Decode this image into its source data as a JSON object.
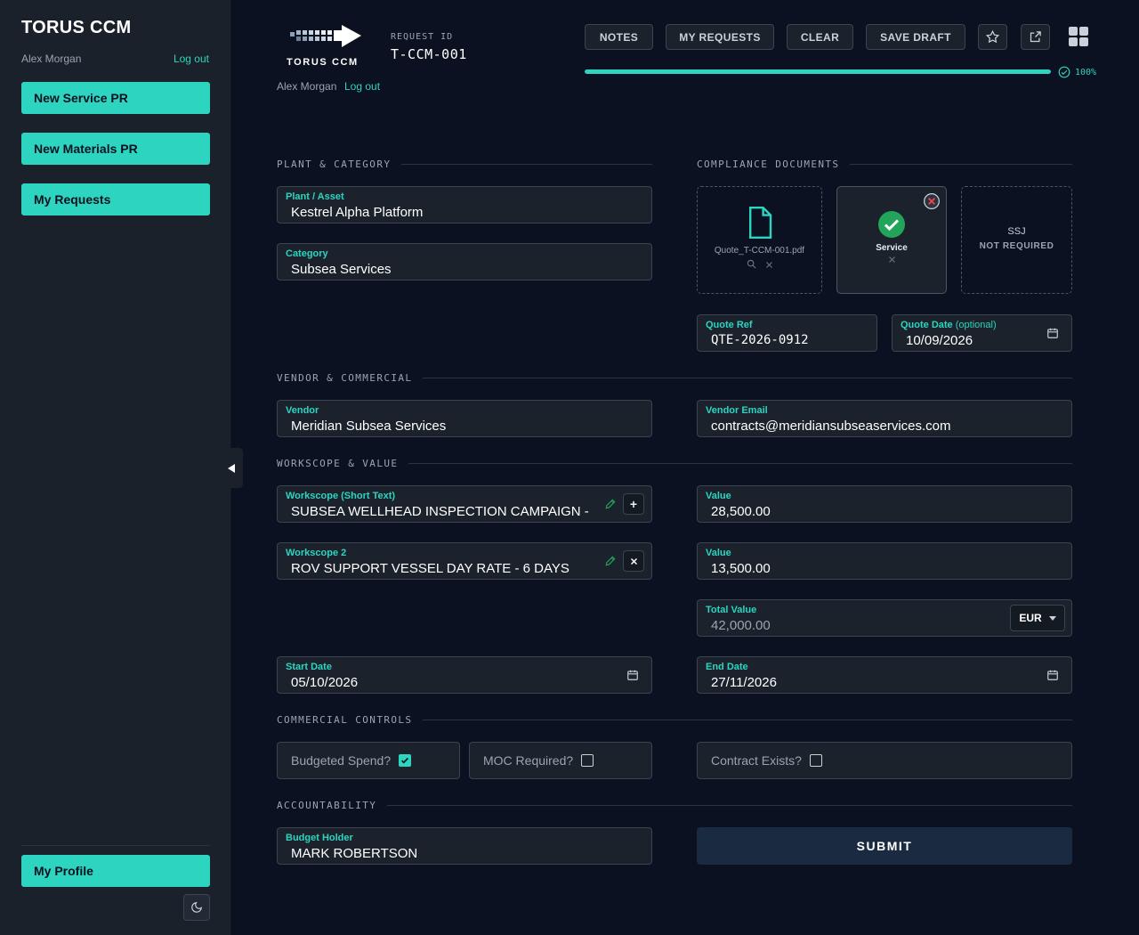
{
  "app": {
    "title": "TORUS CCM",
    "user": "Alex Morgan",
    "logout_label": "Log out"
  },
  "sidebar": {
    "items": [
      {
        "label": "New Service PR"
      },
      {
        "label": "New Materials PR"
      },
      {
        "label": "My Requests"
      }
    ],
    "profile_label": "My Profile"
  },
  "header": {
    "logo_text": "TORUS CCM",
    "request_id_label": "REQUEST ID",
    "request_id": "T-CCM-001",
    "buttons": {
      "notes": "NOTES",
      "my_requests": "MY REQUESTS",
      "clear": "CLEAR",
      "save_draft": "SAVE DRAFT"
    },
    "progress": {
      "value": 1.0,
      "label": "100%"
    }
  },
  "sections": {
    "plant_category": "PLANT & CATEGORY",
    "compliance_documents": "COMPLIANCE DOCUMENTS",
    "vendor_commercial": "VENDOR & COMMERCIAL",
    "workscope_value": "WORKSCOPE & VALUE",
    "commercial_controls": "COMMERCIAL CONTROLS",
    "accountability": "ACCOUNTABILITY"
  },
  "fields": {
    "plant_asset": {
      "label": "Plant / Asset",
      "value": "Kestrel Alpha Platform"
    },
    "category": {
      "label": "Category",
      "value": "Subsea Services"
    },
    "quote_ref": {
      "label": "Quote Ref",
      "value": "QTE-2026-0912"
    },
    "quote_date": {
      "label": "Quote Date",
      "label_suffix": "(optional)",
      "value": "10/09/2026"
    },
    "vendor": {
      "label": "Vendor",
      "value": "Meridian Subsea Services"
    },
    "vendor_email": {
      "label": "Vendor Email",
      "value": "contracts@meridiansubseaservices.com"
    },
    "workscope_1": {
      "label": "Workscope (Short Text)",
      "value": "SUBSEA WELLHEAD INSPECTION CAMPAIGN - PHA"
    },
    "workscope_2": {
      "label": "Workscope 2",
      "value": "ROV SUPPORT VESSEL DAY RATE - 6 DAYS"
    },
    "value_1": {
      "label": "Value",
      "value": "28,500.00"
    },
    "value_2": {
      "label": "Value",
      "value": "13,500.00"
    },
    "total_value": {
      "label": "Total Value",
      "value": "42,000.00",
      "currency": "EUR"
    },
    "start_date": {
      "label": "Start Date",
      "value": "05/10/2026"
    },
    "end_date": {
      "label": "End Date",
      "value": "27/11/2026"
    },
    "budget_holder": {
      "label": "Budget Holder",
      "value": "MARK ROBERTSON"
    }
  },
  "documents": {
    "quote": {
      "filename": "Quote_T-CCM-001.pdf"
    },
    "service": {
      "label": "Service"
    },
    "ssj": {
      "label": "SSJ",
      "status": "NOT REQUIRED"
    }
  },
  "controls": {
    "budgeted_spend": {
      "label": "Budgeted Spend?",
      "checked": true
    },
    "moc_required": {
      "label": "MOC Required?",
      "checked": false
    },
    "contract_exists": {
      "label": "Contract Exists?",
      "checked": false
    }
  },
  "submit_label": "SUBMIT",
  "colors": {
    "accent": "#2dd4bf",
    "background": "#0b1120",
    "sidebar": "#1a212b",
    "field": "#1b222c"
  }
}
